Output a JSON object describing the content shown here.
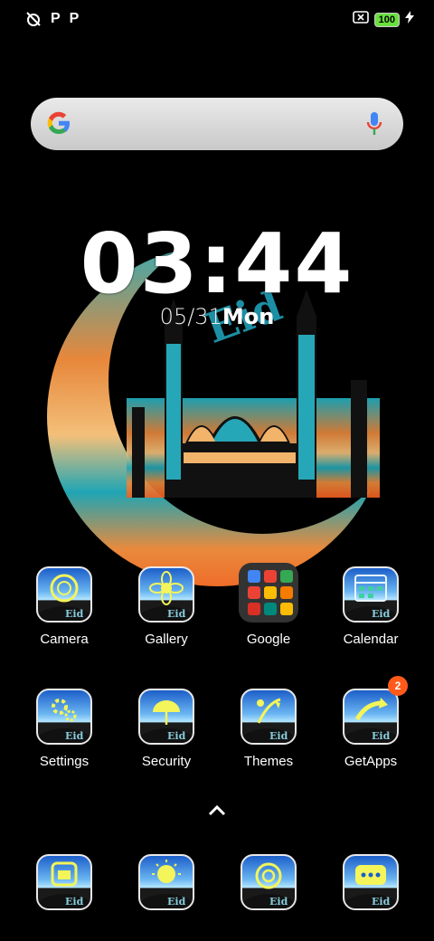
{
  "status_bar": {
    "left_icons": [
      "alarm-off-icon"
    ],
    "notif_1": "P",
    "notif_2": "P",
    "battery": "100"
  },
  "search": {
    "logo": "G"
  },
  "clock": {
    "time": "03:44",
    "date": "05/31",
    "weekday": "Mon"
  },
  "apps_row1": [
    {
      "label": "Camera"
    },
    {
      "label": "Gallery"
    },
    {
      "label": "Google"
    },
    {
      "label": "Calendar"
    }
  ],
  "apps_row2": [
    {
      "label": "Settings"
    },
    {
      "label": "Security"
    },
    {
      "label": "Themes"
    },
    {
      "label": "GetApps",
      "badge": "2"
    }
  ],
  "dock": [
    {
      "icon": "phone-icon"
    },
    {
      "icon": "browser-icon"
    },
    {
      "icon": "contacts-icon"
    },
    {
      "icon": "messages-icon"
    }
  ],
  "colors": {
    "icon_sky_top": "#1c5fc9",
    "icon_sky_bottom": "#b4e6ff",
    "badge": "#ff5a1a",
    "battery": "#6adf3f"
  }
}
